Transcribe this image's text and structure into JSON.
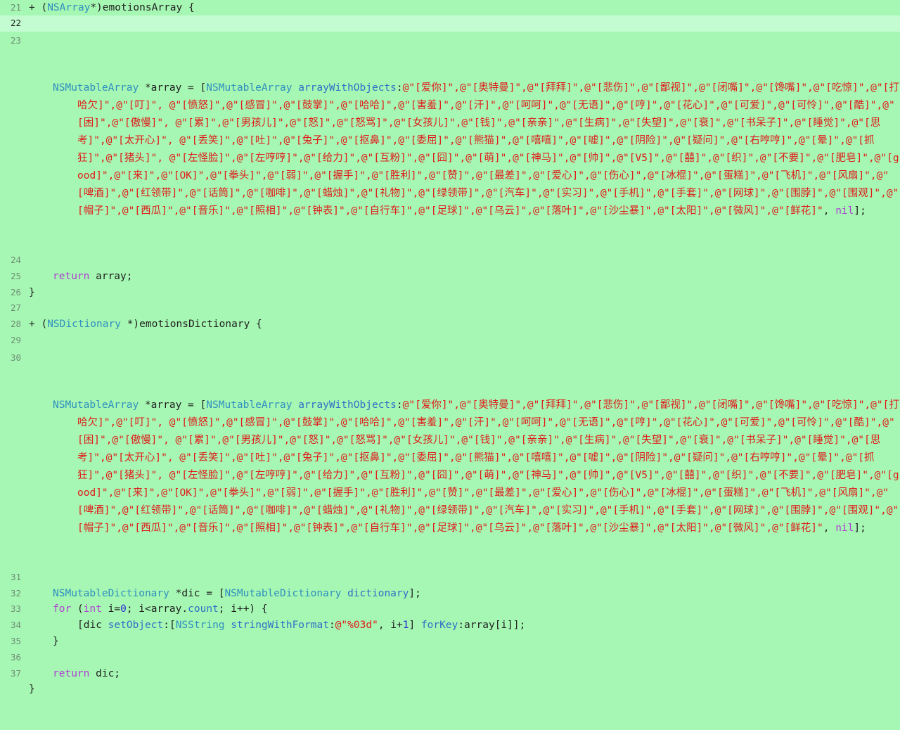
{
  "lines": {
    "l21": {
      "num": "21",
      "p1": "+ (",
      "t1": "NSArray",
      "p2": "*)emotionsArray {"
    },
    "l22": {
      "num": "22"
    },
    "l23": {
      "num": "23",
      "t1": "NSMutableArray",
      "p1": " *array = [",
      "t2": "NSMutableArray",
      "f1": "arrayWithObjects",
      "p2": ":",
      "s1": "@\"[爱你]\",@\"[奥特曼]\",@\"[拜拜]\",@\"[悲伤]\",@\"[鄙视]\",@\"[闭嘴]\",@\"[馋嘴]\",@\"[吃惊]\",@\"[打哈欠]\",@\"[叮]\", @\"[愤怒]\",@\"[感冒]\",@\"[鼓掌]\",@\"[哈哈]\",@\"[害羞]\",@\"[汗]\",@\"[呵呵]\",@\"[无语]\",@\"[哼]\",@\"[花心]\",@\"[可爱]\",@\"[可怜]\",@\"[酷]\",@\"[困]\",@\"[傲慢]\", @\"[累]\",@\"[男孩儿]\",@\"[怒]\",@\"[怒骂]\",@\"[女孩儿]\",@\"[钱]\",@\"[亲亲]\",@\"[生病]\",@\"[失望]\",@\"[衰]\",@\"[书呆子]\",@\"[睡觉]\",@\"[思考]\",@\"[太开心]\", @\"[丢笑]\",@\"[吐]\",@\"[兔子]\",@\"[抠鼻]\",@\"[委屈]\",@\"[熊猫]\",@\"[嘻嘻]\",@\"[嘘]\",@\"[阴险]\",@\"[疑问]\",@\"[右哼哼]\",@\"[晕]\",@\"[抓狂]\",@\"[猪头]\", @\"[左怪脸]\",@\"[左哼哼]\",@\"[给力]\",@\"[互粉]\",@\"[囧]\",@\"[萌]\",@\"[神马]\",@\"[帅]\",@\"[V5]\",@\"[囍]\",@\"[织]\",@\"[不要]\",@\"[肥皂]\",@\"[good]\",@\"[来]\",@\"[OK]\",@\"[拳头]\",@\"[弱]\",@\"[握手]\",@\"[胜利]\",@\"[赞]\",@\"[最差]\",@\"[爱心]\",@\"[伤心]\",@\"[冰棍]\",@\"[蛋糕]\",@\"[飞机]\",@\"[风扇]\",@\"[啤酒]\",@\"[红领带]\",@\"[话筒]\",@\"[咖啡]\",@\"[蜡烛]\",@\"[礼物]\",@\"[绿领带]\",@\"[汽车]\",@\"[实习]\",@\"[手机]\",@\"[手套]\",@\"[网球]\",@\"[围脖]\",@\"[围观]\",@\"[帽子]\",@\"[西瓜]\",@\"[音乐]\",@\"[照相]\",@\"[钟表]\",@\"[自行车]\",@\"[足球]\",@\"[乌云]\",@\"[落叶]\",@\"[沙尘暴]\",@\"[太阳]\",@\"[微风]\",@\"[鲜花]\"",
      "p3": ", ",
      "k1": "nil",
      "p4": "];"
    },
    "l24": {
      "num": "24"
    },
    "l25": {
      "num": "25",
      "k1": "return",
      "p1": " array;"
    },
    "l26": {
      "num": "26",
      "p1": "}"
    },
    "l27": {
      "num": "27"
    },
    "l28": {
      "num": "28",
      "p1": "+ (",
      "t1": "NSDictionary",
      "p2": " *)emotionsDictionary {"
    },
    "l29": {
      "num": "29"
    },
    "l30": {
      "num": "30",
      "t1": "NSMutableArray",
      "p1": " *array = [",
      "t2": "NSMutableArray",
      "f1": "arrayWithObjects",
      "p2": ":",
      "s1": "@\"[爱你]\",@\"[奥特曼]\",@\"[拜拜]\",@\"[悲伤]\",@\"[鄙视]\",@\"[闭嘴]\",@\"[馋嘴]\",@\"[吃惊]\",@\"[打哈欠]\",@\"[叮]\", @\"[愤怒]\",@\"[感冒]\",@\"[鼓掌]\",@\"[哈哈]\",@\"[害羞]\",@\"[汗]\",@\"[呵呵]\",@\"[无语]\",@\"[哼]\",@\"[花心]\",@\"[可爱]\",@\"[可怜]\",@\"[酷]\",@\"[困]\",@\"[傲慢]\", @\"[累]\",@\"[男孩儿]\",@\"[怒]\",@\"[怒骂]\",@\"[女孩儿]\",@\"[钱]\",@\"[亲亲]\",@\"[生病]\",@\"[失望]\",@\"[衰]\",@\"[书呆子]\",@\"[睡觉]\",@\"[思考]\",@\"[太开心]\", @\"[丢笑]\",@\"[吐]\",@\"[兔子]\",@\"[抠鼻]\",@\"[委屈]\",@\"[熊猫]\",@\"[嘻嘻]\",@\"[嘘]\",@\"[阴险]\",@\"[疑问]\",@\"[右哼哼]\",@\"[晕]\",@\"[抓狂]\",@\"[猪头]\", @\"[左怪脸]\",@\"[左哼哼]\",@\"[给力]\",@\"[互粉]\",@\"[囧]\",@\"[萌]\",@\"[神马]\",@\"[帅]\",@\"[V5]\",@\"[囍]\",@\"[织]\",@\"[不要]\",@\"[肥皂]\",@\"[good]\",@\"[来]\",@\"[OK]\",@\"[拳头]\",@\"[弱]\",@\"[握手]\",@\"[胜利]\",@\"[赞]\",@\"[最差]\",@\"[爱心]\",@\"[伤心]\",@\"[冰棍]\",@\"[蛋糕]\",@\"[飞机]\",@\"[风扇]\",@\"[啤酒]\",@\"[红领带]\",@\"[话筒]\",@\"[咖啡]\",@\"[蜡烛]\",@\"[礼物]\",@\"[绿领带]\",@\"[汽车]\",@\"[实习]\",@\"[手机]\",@\"[手套]\",@\"[网球]\",@\"[围脖]\",@\"[围观]\",@\"[帽子]\",@\"[西瓜]\",@\"[音乐]\",@\"[照相]\",@\"[钟表]\",@\"[自行车]\",@\"[足球]\",@\"[乌云]\",@\"[落叶]\",@\"[沙尘暴]\",@\"[太阳]\",@\"[微风]\",@\"[鲜花]\"",
      "p3": ", ",
      "k1": "nil",
      "p4": "];"
    },
    "l31": {
      "num": "31"
    },
    "l32": {
      "num": "32",
      "t1": "NSMutableDictionary",
      "p1": " *dic = [",
      "t2": "NSMutableDictionary",
      "f1": "dictionary",
      "p2": "];"
    },
    "l33": {
      "num": "33",
      "k1": "for",
      "p1": " (",
      "k2": "int",
      "p2": " i=",
      "n1": "0",
      "p3": "; i<array.",
      "f1": "count",
      "p4": "; i++) {"
    },
    "l34": {
      "num": "34",
      "p1": "[dic ",
      "f1": "setObject",
      "p2": ":[",
      "t1": "NSString",
      "f2": "stringWithFormat",
      "p3": ":",
      "s1": "@\"%03d\"",
      "p4": ", i+",
      "n1": "1",
      "p5": "] ",
      "f3": "forKey",
      "p6": ":array[i]];"
    },
    "l35": {
      "num": "35",
      "p1": "}"
    },
    "l36": {
      "num": "36"
    },
    "l37": {
      "num": "37",
      "k1": "return",
      "p1": " dic;"
    },
    "l38": {
      "p1": "}"
    }
  },
  "colors": {
    "background": "#a6f7b3",
    "current_line": "#c3fcd0",
    "keyword": "#b03fd4",
    "type": "#2f8fc0",
    "string": "#e01a1a"
  }
}
